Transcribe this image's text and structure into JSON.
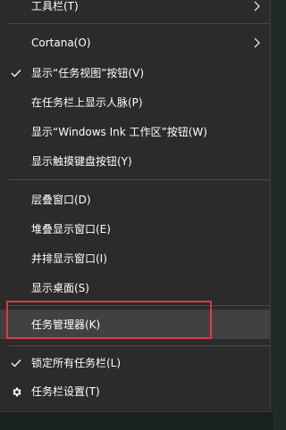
{
  "menu": {
    "items": [
      {
        "label": "工具栏(T)",
        "submenu": true
      },
      {
        "label": "Cortana(O)",
        "submenu": true
      },
      {
        "label": "显示“任务视图”按钮(V)",
        "checked": true
      },
      {
        "label": "在任务栏上显示人脉(P)"
      },
      {
        "label": "显示“Windows Ink 工作区”按钮(W)"
      },
      {
        "label": "显示触摸键盘按钮(Y)"
      },
      {
        "label": "层叠窗口(D)"
      },
      {
        "label": "堆叠显示窗口(E)"
      },
      {
        "label": "并排显示窗口(I)"
      },
      {
        "label": "显示桌面(S)"
      },
      {
        "label": "任务管理器(K)",
        "highlighted": true
      },
      {
        "label": "锁定所有任务栏(L)",
        "checked": true
      },
      {
        "label": "任务栏设置(T)",
        "icon": "gear-icon"
      }
    ]
  },
  "colors": {
    "menu_bg": "#2b2b2b",
    "highlight_bg": "#414141",
    "text": "#ffffff",
    "annotation": "#e0393e"
  }
}
